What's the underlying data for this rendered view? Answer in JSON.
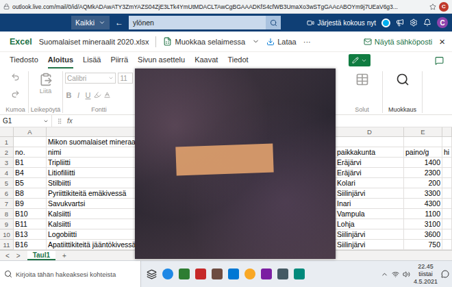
{
  "browser": {
    "url": "outlook.live.com/mail/0/id/AQMkADAwATY3ZmYAZS04ZjE3LTk4YmUtMDACLTAwCgBGAAADKfS4cfWB3UmaXo3wSTgGAAcABOYm9j7UEaV6g3...",
    "avatar": "C"
  },
  "outlook": {
    "scope": "Kaikki",
    "back": "←",
    "search": "ylönen",
    "meeting": "Järjestä kokous nyt",
    "avatar": "C"
  },
  "excel": {
    "app": "Excel",
    "file": "Suomalaiset mineraalit 2020.xlsx",
    "edit": "Muokkaa selaimessa",
    "download": "Lataa",
    "more": "···",
    "show_mail": "Näytä sähköposti",
    "close": "×"
  },
  "tabs": [
    {
      "label": "Tiedosto",
      "selected": false
    },
    {
      "label": "Aloitus",
      "selected": true
    },
    {
      "label": "Lisää",
      "selected": false
    },
    {
      "label": "Piirrä",
      "selected": false
    },
    {
      "label": "Sivun asettelu",
      "selected": false
    },
    {
      "label": "Kaavat",
      "selected": false
    },
    {
      "label": "Tiedot",
      "selected": false
    }
  ],
  "ribbon": {
    "undo": {
      "label": "Kumoa",
      "disabled": true
    },
    "paste": {
      "label": "Liitä",
      "group": "Leikepöytä",
      "disabled": true
    },
    "font": {
      "name": "Calibri",
      "size": "11",
      "group": "Fontti",
      "styles": [
        {
          "label": "B",
          "disabled": true
        },
        {
          "label": "I",
          "disabled": true
        },
        {
          "label": "U",
          "disabled": true
        }
      ]
    },
    "cells": {
      "label": "Solut",
      "disabled": true
    },
    "editing": {
      "label": "Muokkaus",
      "disabled": false
    }
  },
  "formula_bar": {
    "cell": "G1",
    "fx": "fx"
  },
  "sheet": {
    "columns": [
      "A",
      "",
      "",
      "D",
      "E",
      ""
    ],
    "rows": [
      {
        "num": "1",
        "cells": [
          "",
          "Mikon suomalaiset mineraalit",
          "",
          "",
          "",
          ""
        ]
      },
      {
        "num": "2",
        "cells": [
          "no.",
          "nimi",
          "",
          "paikkakunta",
          "paino/g",
          "hi"
        ]
      },
      {
        "num": "3",
        "cells": [
          "B1",
          "Tripliitti",
          "",
          "Eräjärvi",
          "1400",
          ""
        ]
      },
      {
        "num": "4",
        "cells": [
          "B4",
          "Litiofiliitti",
          "",
          "Eräjärvi",
          "2300",
          ""
        ]
      },
      {
        "num": "5",
        "cells": [
          "B5",
          "Stilbiitti",
          "",
          "Kolari",
          "200",
          ""
        ]
      },
      {
        "num": "6",
        "cells": [
          "B8",
          "Pyriittikiteitä emäkivessä",
          "",
          "Siilinjärvi",
          "3300",
          ""
        ]
      },
      {
        "num": "7",
        "cells": [
          "B9",
          "Savukvartsi",
          "",
          "Inari",
          "4300",
          ""
        ]
      },
      {
        "num": "8",
        "cells": [
          "B10",
          "Kalsiitti",
          "",
          "Vampula",
          "1100",
          ""
        ]
      },
      {
        "num": "9",
        "cells": [
          "B11",
          "Kalsiitti",
          "",
          "Lohja",
          "3100",
          ""
        ]
      },
      {
        "num": "10",
        "cells": [
          "B13",
          "Logobiitti",
          "",
          "Siilinjärvi",
          "3600",
          ""
        ]
      },
      {
        "num": "11",
        "cells": [
          "B16",
          "Apatiittikiteitä jääntökivessä",
          "",
          "Siilinjärvi",
          "750",
          ""
        ]
      }
    ]
  },
  "sheet_tabs": {
    "prev": "<",
    "next": ">",
    "tabs": [
      {
        "label": "Taul1",
        "selected": true
      }
    ],
    "add": "+"
  },
  "taskbar": {
    "search": "Kirjoita tähän hakeaksesi kohteista",
    "time": "22.45",
    "day": "tiistai",
    "date": "4.5.2021"
  }
}
